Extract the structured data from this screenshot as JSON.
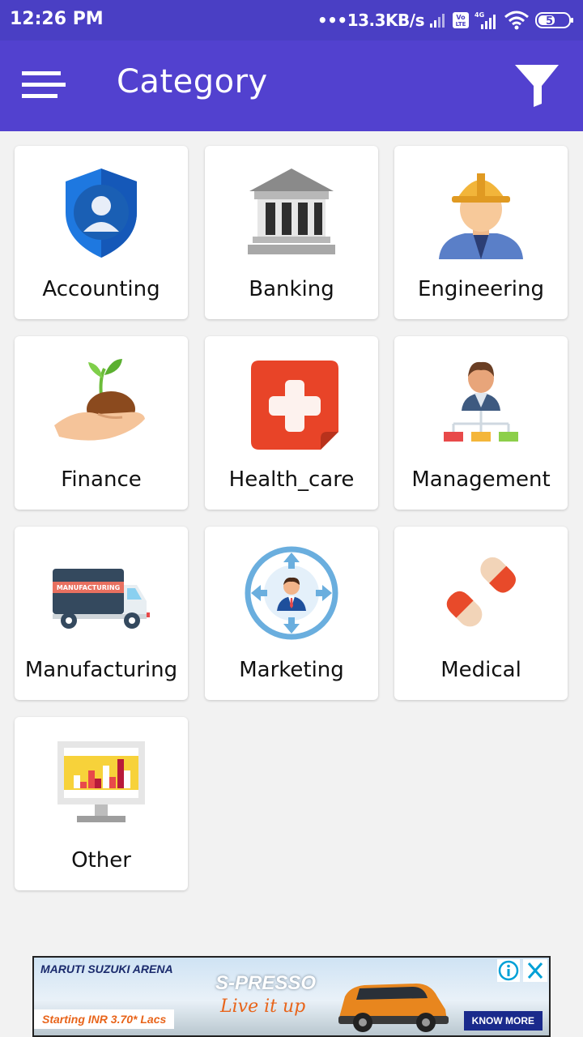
{
  "status_bar": {
    "time": "12:26 PM",
    "net_speed": "13.3KB/s",
    "volte": "Vo LTE",
    "network_type": "4G",
    "battery": "51",
    "icons": [
      "signal-icon",
      "volte-icon",
      "4g-signal-icon",
      "wifi-icon",
      "battery-icon"
    ]
  },
  "app_bar": {
    "title": "Category",
    "menu_icon": "hamburger-menu-icon",
    "filter_icon": "filter-icon",
    "background": "#5241cf"
  },
  "categories": [
    {
      "label": "Accounting",
      "icon": "shield-user-icon"
    },
    {
      "label": "Banking",
      "icon": "bank-building-icon"
    },
    {
      "label": "Engineering",
      "icon": "engineer-hardhat-icon"
    },
    {
      "label": "Finance",
      "icon": "hand-sprout-icon"
    },
    {
      "label": "Health_care",
      "icon": "medical-cross-icon"
    },
    {
      "label": "Management",
      "icon": "org-chart-icon"
    },
    {
      "label": "Manufacturing",
      "icon": "manufacturing-truck-icon"
    },
    {
      "label": "Marketing",
      "icon": "target-person-icon"
    },
    {
      "label": "Medical",
      "icon": "pills-icon"
    },
    {
      "label": "Other",
      "icon": "monitor-chart-icon"
    }
  ],
  "ad": {
    "brand": "MARUTI SUZUKI ARENA",
    "product": "S-PRESSO",
    "tagline": "Live it up",
    "price": "Starting INR  3.70* Lacs",
    "cta": "KNOW MORE",
    "truck_text": "MANUFACTURING"
  }
}
